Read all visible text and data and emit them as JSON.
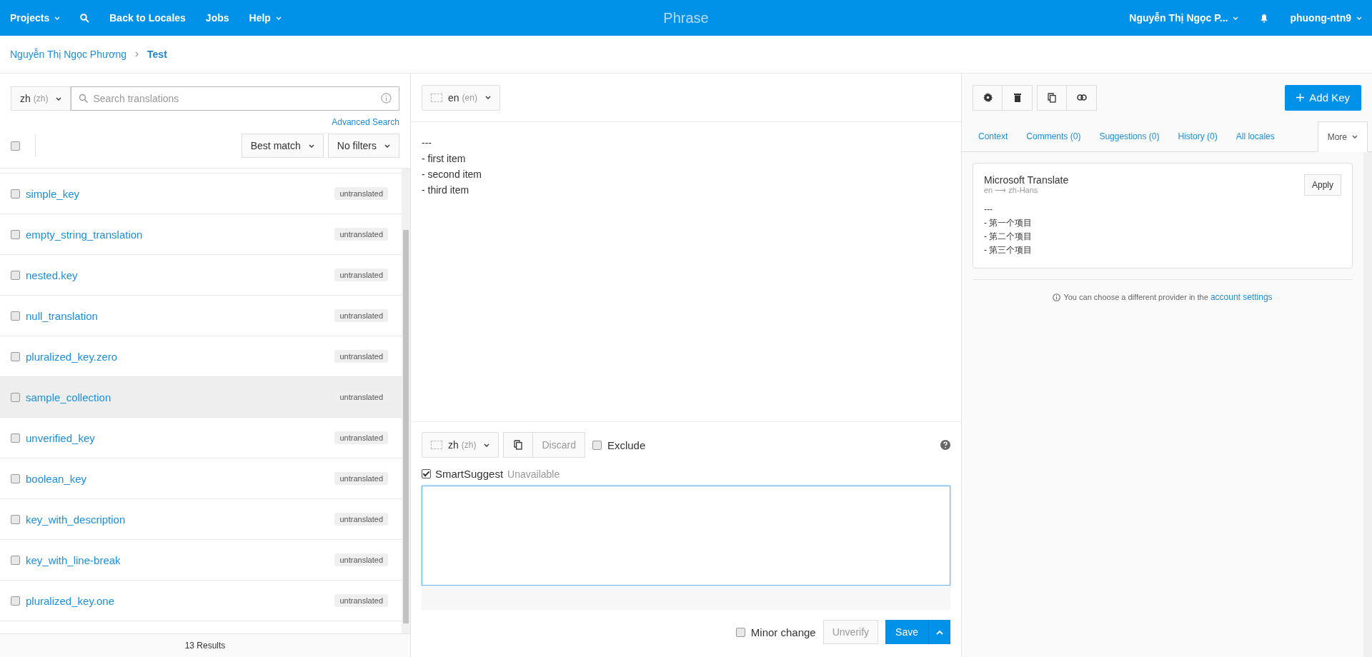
{
  "nav": {
    "items": [
      {
        "label": "Projects",
        "kind": "menu"
      },
      {
        "kind": "search"
      },
      {
        "label": "Back to Locales",
        "kind": "link"
      },
      {
        "label": "Jobs",
        "kind": "link"
      },
      {
        "label": "Help",
        "kind": "menu"
      }
    ],
    "title": "Phrase",
    "user": "Nguyễn Thị Ngọc P...",
    "account": "phuong-ntn9"
  },
  "breadcrumb": [
    {
      "label": "Nguyễn Thị Ngọc Phương",
      "selected": false
    },
    {
      "label": "Test",
      "selected": true
    }
  ],
  "keys_panel": {
    "locale": {
      "code": "zh",
      "sub": "(zh)"
    },
    "search": {
      "placeholder": "Search translations"
    },
    "advanced_search": "Advanced Search",
    "select_all_checked": false,
    "sort": "Best match",
    "filter": "No filters",
    "rows": [
      {
        "name": "simple_key",
        "status": "untranslated",
        "selected": false,
        "checked": false
      },
      {
        "name": "empty_string_translation",
        "status": "untranslated",
        "selected": false,
        "checked": false
      },
      {
        "name": "nested.key",
        "status": "untranslated",
        "selected": false,
        "checked": false
      },
      {
        "name": "null_translation",
        "status": "untranslated",
        "selected": false,
        "checked": false
      },
      {
        "name": "pluralized_key.zero",
        "status": "untranslated",
        "selected": false,
        "checked": false
      },
      {
        "name": "sample_collection",
        "status": "untranslated",
        "selected": true,
        "checked": false
      },
      {
        "name": "unverified_key",
        "status": "untranslated",
        "selected": false,
        "checked": false
      },
      {
        "name": "boolean_key",
        "status": "untranslated",
        "selected": false,
        "checked": false
      },
      {
        "name": "key_with_description",
        "status": "untranslated",
        "selected": false,
        "checked": false
      },
      {
        "name": "key_with_line-break",
        "status": "untranslated",
        "selected": false,
        "checked": false
      },
      {
        "name": "pluralized_key.one",
        "status": "untranslated",
        "selected": false,
        "checked": false
      }
    ],
    "results": "13 Results"
  },
  "source": {
    "locale": {
      "code": "en",
      "sub": "(en)"
    },
    "lines": [
      "---",
      "- first item",
      "- second item",
      "- third item"
    ]
  },
  "editor": {
    "locale": {
      "code": "zh",
      "sub": "(zh)"
    },
    "discard": "Discard",
    "exclude": {
      "label": "Exclude",
      "checked": false
    },
    "smart_suggest": {
      "label": "SmartSuggest",
      "status": "Unavailable",
      "checked": true
    },
    "minor_change": {
      "label": "Minor change",
      "checked": false
    },
    "unverify": "Unverify",
    "save": "Save"
  },
  "detail": {
    "add_key": "Add Key",
    "tabs": [
      {
        "label": "Context",
        "selected": false
      },
      {
        "label": "Comments (0)",
        "selected": false
      },
      {
        "label": "Suggestions (0)",
        "selected": false
      },
      {
        "label": "History (0)",
        "selected": false
      },
      {
        "label": "All locales",
        "selected": false
      },
      {
        "label": "More",
        "selected": true
      }
    ],
    "suggestion": {
      "provider": "Microsoft Translate",
      "direction": "en ⟶ zh-Hans",
      "apply": "Apply",
      "lines": [
        "---",
        "- 第一个项目",
        "- 第二个项目",
        "- 第三个项目"
      ]
    },
    "info": {
      "text": "You can choose a different provider in the",
      "link": "account settings"
    }
  }
}
